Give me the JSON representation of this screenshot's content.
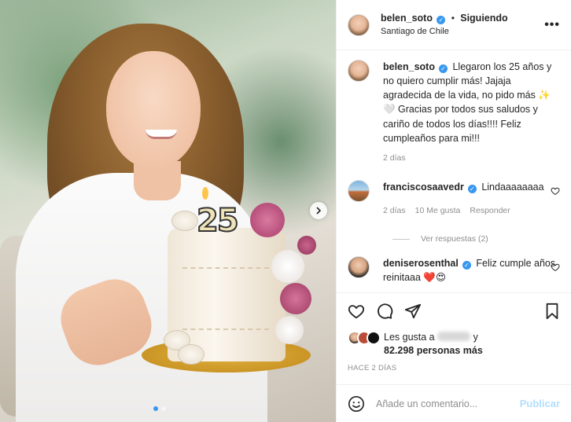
{
  "header": {
    "username": "belen_soto",
    "separator": "•",
    "follow_status": "Siguiendo",
    "location": "Santiago de Chile",
    "more": "•••"
  },
  "caption": {
    "username": "belen_soto",
    "text": "Llegaron los 25 años y no quiero cumplir más! Jajaja agradecida de la vida, no pido más ✨🤍 Gracias por todos sus saludos y cariño de todos los días!!!! Feliz cumpleaños para mi!!!",
    "time": "2 días"
  },
  "comments": [
    {
      "username": "franciscosaavedr",
      "text": "Lindaaaaaaaa",
      "time": "2 días",
      "likes": "10 Me gusta",
      "reply": "Responder",
      "view_replies": "Ver respuestas (2)"
    },
    {
      "username": "deniserosenthal",
      "text": "Feliz cumple años reinitaaa ❤️😍"
    }
  ],
  "likes": {
    "prefix": "Les gusta a",
    "suffix": "y",
    "count_text": "82.298 personas más"
  },
  "posted_ago": "HACE 2 DÍAS",
  "add_comment": {
    "placeholder": "Añade un comentario...",
    "publish": "Publicar"
  },
  "photo": {
    "cake_number": "25"
  },
  "colors": {
    "verified": "#3897f0",
    "muted": "#8e8e8e",
    "publish_disabled": "#b2dffc"
  }
}
